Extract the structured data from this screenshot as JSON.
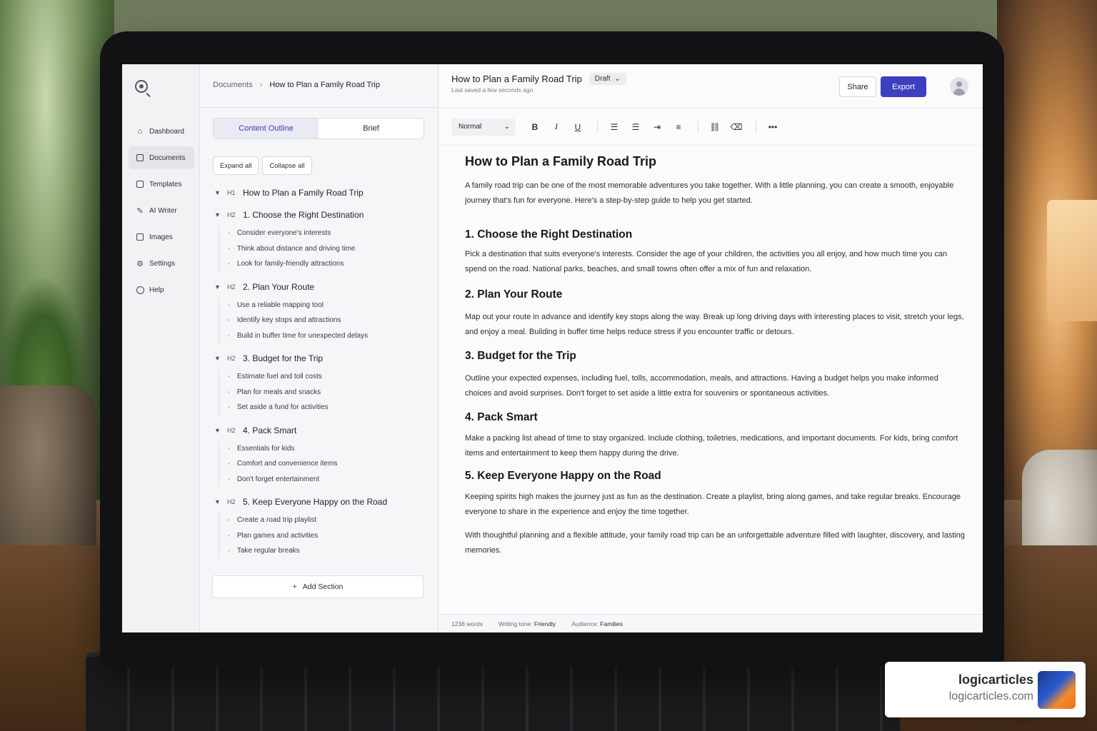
{
  "sidebar": {
    "items": [
      {
        "label": "Dashboard",
        "icon": "home-icon",
        "active": false
      },
      {
        "label": "Documents",
        "icon": "document-icon",
        "active": true
      },
      {
        "label": "Templates",
        "icon": "template-icon",
        "active": false
      },
      {
        "label": "AI Writer",
        "icon": "pen-icon",
        "active": false
      },
      {
        "label": "Images",
        "icon": "image-icon",
        "active": false
      },
      {
        "label": "Settings",
        "icon": "gear-icon",
        "active": false
      },
      {
        "label": "Help",
        "icon": "help-icon",
        "active": false
      }
    ]
  },
  "breadcrumb": {
    "root": "Documents",
    "current": "How to Plan a Family Road Trip"
  },
  "outline": {
    "tabs": [
      "Content Outline",
      "Brief"
    ],
    "expand_label": "Expand all",
    "collapse_label": "Collapse all",
    "h1": {
      "level": "H1",
      "title": "How to Plan a Family Road Trip"
    },
    "sections": [
      {
        "level": "H2",
        "title": "1. Choose the Right Destination",
        "items": [
          "Consider everyone's interests",
          "Think about distance and driving time",
          "Look for family-friendly attractions"
        ]
      },
      {
        "level": "H2",
        "title": "2. Plan Your Route",
        "items": [
          "Use a reliable mapping tool",
          "Identify key stops and attractions",
          "Build in buffer time for unexpected delays"
        ]
      },
      {
        "level": "H2",
        "title": "3. Budget for the Trip",
        "items": [
          "Estimate fuel and toll costs",
          "Plan for meals and snacks",
          "Set aside a fund for activities"
        ]
      },
      {
        "level": "H2",
        "title": "4. Pack Smart",
        "items": [
          "Essentials for kids",
          "Comfort and convenience items",
          "Don't forget entertainment"
        ]
      },
      {
        "level": "H2",
        "title": "5. Keep Everyone Happy on the Road",
        "items": [
          "Create a road trip playlist",
          "Plan games and activities",
          "Take regular breaks"
        ]
      }
    ],
    "add_section_label": "Add Section"
  },
  "header": {
    "title": "How to Plan a Family Road Trip",
    "status": "Draft",
    "saved": "Last saved a few seconds ago",
    "share_label": "Share",
    "export_label": "Export"
  },
  "toolbar": {
    "style": "Normal"
  },
  "document": {
    "title": "How to Plan a Family Road Trip",
    "intro": "A family road trip can be one of the most memorable adventures you take together. With a little planning, you can create a smooth, enjoyable journey that's fun for everyone. Here's a step-by-step guide to help you get started.",
    "sections": [
      {
        "heading": "1. Choose the Right Destination",
        "body": "Pick a destination that suits everyone's interests. Consider the age of your children, the activities you all enjoy, and how much time you can spend on the road. National parks, beaches, and small towns often offer a mix of fun and relaxation."
      },
      {
        "heading": "2. Plan Your Route",
        "body": "Map out your route in advance and identify key stops along the way. Break up long driving days with interesting places to visit, stretch your legs, and enjoy a meal. Building in buffer time helps reduce stress if you encounter traffic or detours."
      },
      {
        "heading": "3. Budget for the Trip",
        "body": "Outline your expected expenses, including fuel, tolls, accommodation, meals, and attractions. Having a budget helps you make informed choices and avoid surprises. Don't forget to set aside a little extra for souvenirs or spontaneous activities."
      },
      {
        "heading": "4. Pack Smart",
        "body": "Make a packing list ahead of time to stay organized. Include clothing, toiletries, medications, and important documents. For kids, bring comfort items and entertainment to keep them happy during the drive."
      },
      {
        "heading": "5. Keep Everyone Happy on the Road",
        "body": "Keeping spirits high makes the journey just as fun as the destination. Create a playlist, bring along games, and take regular breaks. Encourage everyone to share in the experience and enjoy the time together."
      }
    ],
    "closing": "With thoughtful planning and a flexible attitude, your family road trip can be an unforgettable adventure filled with laughter, discovery, and lasting memories."
  },
  "status_bar": {
    "words": "1238 words",
    "tone_label": "Writing tone:",
    "tone": "Friendly",
    "audience_label": "Audience:",
    "audience": "Families"
  },
  "watermark": {
    "name": "logicarticles",
    "url": "logicarticles.com"
  },
  "colors": {
    "accent": "#3c3fc0"
  }
}
